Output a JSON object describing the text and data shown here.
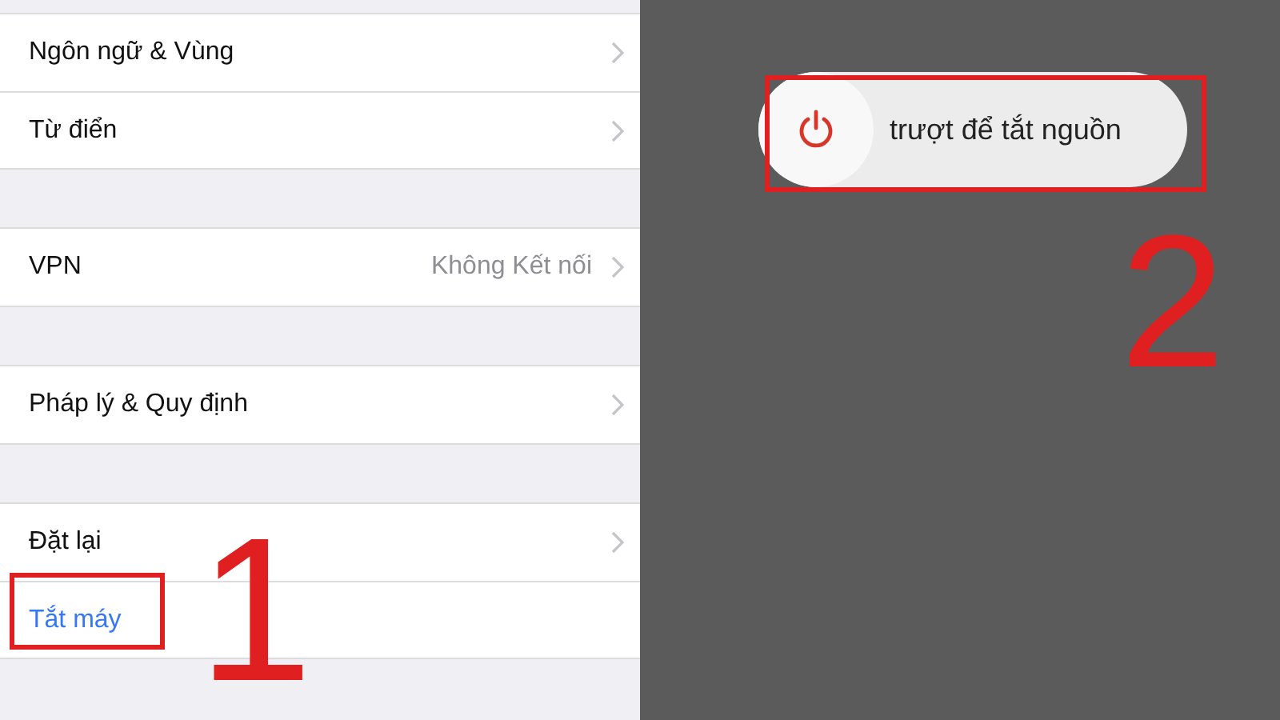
{
  "settings": {
    "sections": [
      {
        "rows": [
          {
            "kind": "nav",
            "label": "Ngôn ngữ & Vùng"
          },
          {
            "kind": "nav",
            "label": "Từ điển"
          }
        ]
      },
      {
        "rows": [
          {
            "kind": "nav",
            "label": "VPN",
            "value": "Không Kết nối"
          }
        ]
      },
      {
        "rows": [
          {
            "kind": "nav",
            "label": "Pháp lý & Quy định"
          }
        ]
      },
      {
        "rows": [
          {
            "kind": "nav",
            "label": "Đặt lại"
          },
          {
            "kind": "action",
            "label": "Tắt máy"
          }
        ]
      }
    ]
  },
  "power_off": {
    "slider_label": "trượt để tắt nguồn",
    "level": 0
  },
  "annotations": [
    {
      "label": "1"
    },
    {
      "label": "2"
    }
  ]
}
